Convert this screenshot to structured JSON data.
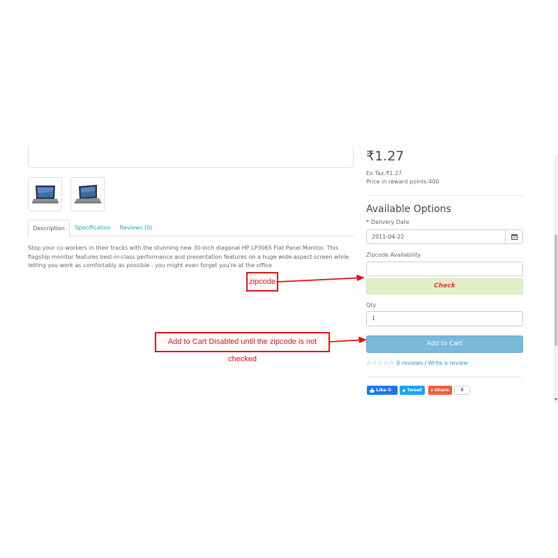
{
  "product": {
    "price": "₹1.27",
    "ex_tax": "Ex Tax:₹1.27",
    "reward_points": "Price in reward points:400",
    "description": "Stop your co-workers in their tracks with the stunning new 30-inch diagonal HP LP3065 Flat Panel Monitor. This flagship monitor features best-in-class performance and presentation features on a huge wide-aspect screen while letting you work as comfortably as possible - you might even forget you're at the office"
  },
  "tabs": [
    {
      "label": "Description"
    },
    {
      "label": "Specification"
    },
    {
      "label": "Reviews (0)"
    }
  ],
  "options": {
    "heading": "Available Options",
    "required_mark": "*",
    "delivery_label": "Delivery Date",
    "delivery_value": "2011-04-22",
    "zipcode_label": "Zipcode Availability",
    "zipcode_value": "",
    "check_label": "Check",
    "qty_label": "Qty",
    "qty_value": "1"
  },
  "cart": {
    "add_label": "Add to Cart",
    "disabled": true
  },
  "reviews": {
    "stars": "☆☆☆☆☆",
    "count_link": "0 reviews",
    "separator": "/",
    "write_link": "Write a review"
  },
  "social": {
    "fb_label": "Like 0",
    "tw_label": "Tweet",
    "share_label": "Share",
    "share_count": "8"
  },
  "annotations": {
    "zipcode_note": "zipcode",
    "cart_note": "Add to Cart Disabled until the zipcode is not checked"
  },
  "colors": {
    "link": "#23a1d1",
    "cart_button": "#72b6d9",
    "check_button_bg": "#dff0c8",
    "check_text": "#e8332b",
    "annotation_red": "#e01010",
    "facebook": "#1877f2",
    "twitter": "#1da1f2",
    "share": "#f05b3b"
  }
}
